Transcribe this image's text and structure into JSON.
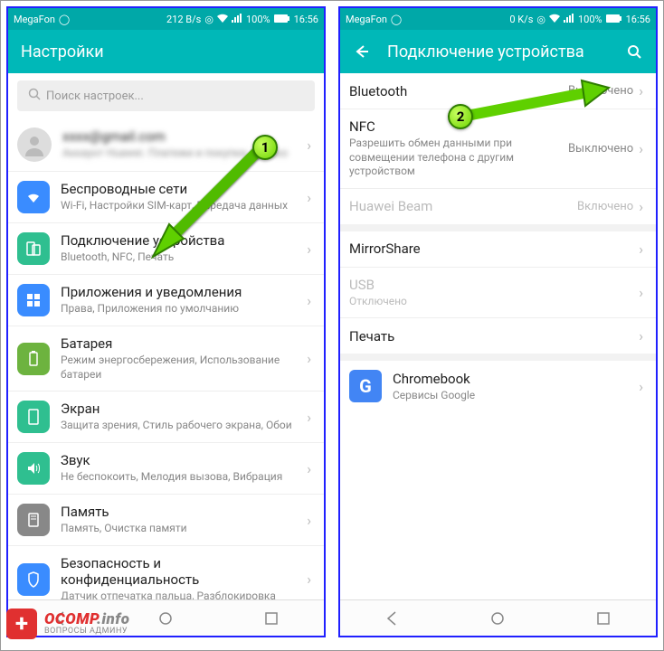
{
  "statusbar": {
    "carrier": "MegaFon",
    "left_speed": "212 B/s",
    "right_speed": "0 K/s",
    "battery": "100%",
    "time": "16:56"
  },
  "left": {
    "title": "Настройки",
    "search_placeholder": "Поиск настроек...",
    "account_line1": "xxxx@gmail.com",
    "account_line2": "Аккаунт Huawei. Платежи и покупки, облако",
    "items": [
      {
        "title": "Беспроводные сети",
        "sub": "Wi-Fi, Настройки SIM-карт, Передача данных",
        "color": "#3a8cff"
      },
      {
        "title": "Подключение устройства",
        "sub": "Bluetooth, NFC, Печать",
        "color": "#2fbf90"
      },
      {
        "title": "Приложения и уведомления",
        "sub": "Права, Приложения по умолчанию",
        "color": "#3a8cff"
      },
      {
        "title": "Батарея",
        "sub": "Режим энергосбережения, Использование батареи",
        "color": "#6db33f"
      },
      {
        "title": "Экран",
        "sub": "Защита зрения, Стиль рабочего экрана, Обои",
        "color": "#2fbf90"
      },
      {
        "title": "Звук",
        "sub": "Не беспокоить, Мелодия вызова, Вибрация",
        "color": "#2fbf90"
      },
      {
        "title": "Память",
        "sub": "Память, Очистка памяти",
        "color": "#888"
      },
      {
        "title": "Безопасность и конфиденциальность",
        "sub": "Датчик отпечатка пальца, Разблокировка",
        "color": "#3a8cff"
      }
    ]
  },
  "right": {
    "title": "Подключение устройства",
    "items": [
      {
        "title": "Bluetooth",
        "sub": "",
        "value": "Выключено",
        "disabled": false
      },
      {
        "title": "NFC",
        "sub": "Разрешить обмен данными при совмещении телефона с другим устройством",
        "value": "Выключено",
        "disabled": false
      },
      {
        "title": "Huawei Beam",
        "sub": "",
        "value": "Включено",
        "disabled": true
      },
      {
        "title": "MirrorShare",
        "sub": "",
        "value": "",
        "disabled": false
      },
      {
        "title": "USB",
        "sub": "Отключено",
        "value": "",
        "disabled": true
      },
      {
        "title": "Печать",
        "sub": "",
        "value": "",
        "disabled": false
      }
    ],
    "chromebook": {
      "title": "Chromebook",
      "sub": "Сервисы Google"
    }
  },
  "callouts": {
    "one": "1",
    "two": "2"
  },
  "watermark": {
    "line1a": "OCOMP",
    "line1b": ".info",
    "line2": "ВОПРОСЫ АДМИНУ"
  }
}
